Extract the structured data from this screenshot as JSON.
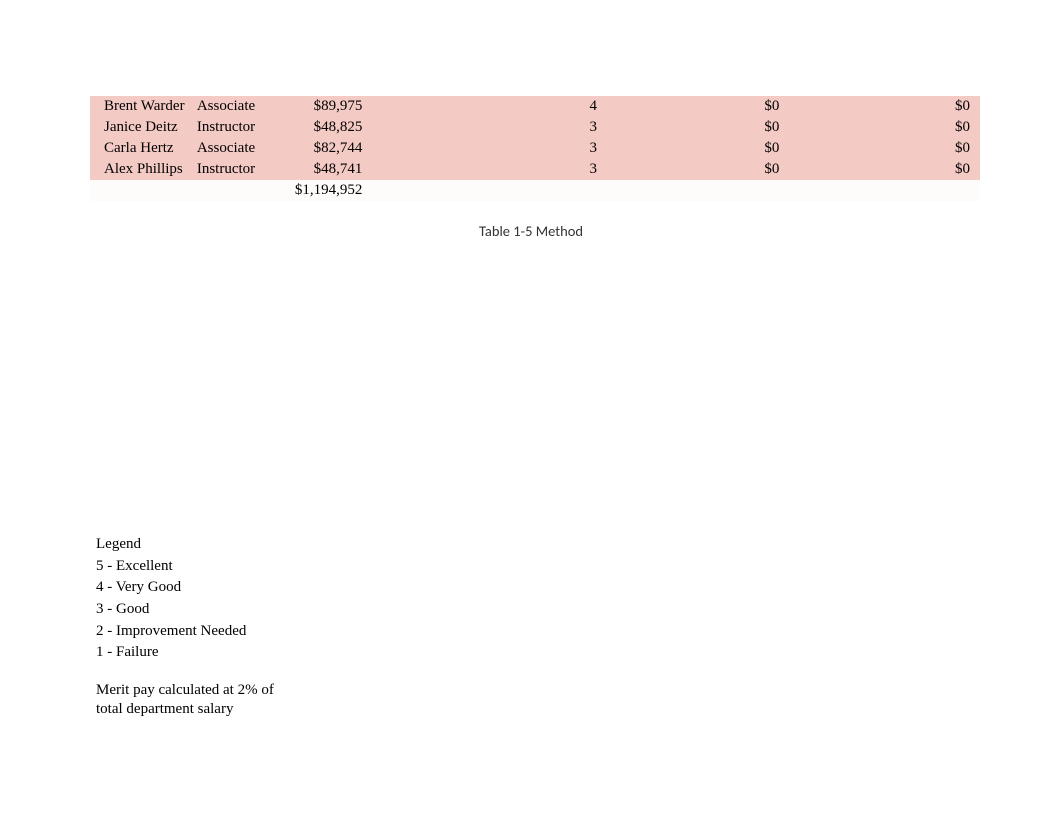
{
  "table": {
    "rows": [
      {
        "name": "Brent Warder",
        "role": "Associate",
        "salary": "$89,975",
        "score": "4",
        "val1": "$0",
        "val2": "$0"
      },
      {
        "name": "Janice Deitz",
        "role": "Instructor",
        "salary": "$48,825",
        "score": "3",
        "val1": "$0",
        "val2": "$0"
      },
      {
        "name": "Carla Hertz",
        "role": "Associate",
        "salary": "$82,744",
        "score": "3",
        "val1": "$0",
        "val2": "$0"
      },
      {
        "name": "Alex Phillips",
        "role": "Instructor",
        "salary": "$48,741",
        "score": "3",
        "val1": "$0",
        "val2": "$0"
      }
    ],
    "total": "$1,194,952"
  },
  "caption": "Table 1-5 Method",
  "legend": {
    "header": "Legend",
    "items": [
      "5 - Excellent",
      "4 - Very Good",
      "3 - Good",
      "2 - Improvement Needed",
      "1 - Failure"
    ],
    "note": "Merit pay calculated at 2% of total department salary"
  }
}
